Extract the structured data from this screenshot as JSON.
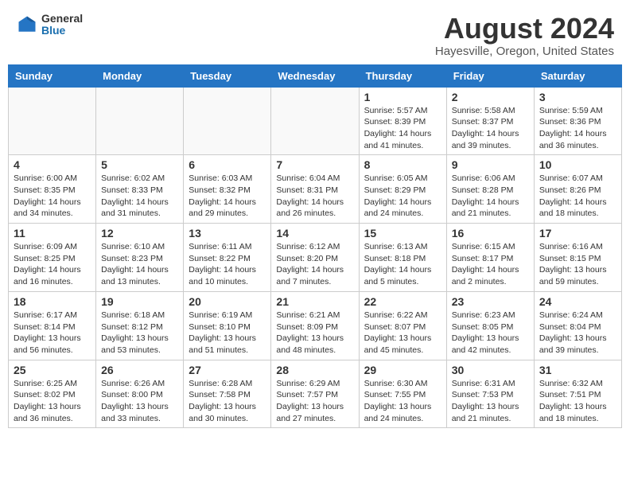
{
  "logo": {
    "general": "General",
    "blue": "Blue"
  },
  "title": "August 2024",
  "subtitle": "Hayesville, Oregon, United States",
  "days_of_week": [
    "Sunday",
    "Monday",
    "Tuesday",
    "Wednesday",
    "Thursday",
    "Friday",
    "Saturday"
  ],
  "weeks": [
    [
      {
        "day": "",
        "info": ""
      },
      {
        "day": "",
        "info": ""
      },
      {
        "day": "",
        "info": ""
      },
      {
        "day": "",
        "info": ""
      },
      {
        "day": "1",
        "info": "Sunrise: 5:57 AM\nSunset: 8:39 PM\nDaylight: 14 hours\nand 41 minutes."
      },
      {
        "day": "2",
        "info": "Sunrise: 5:58 AM\nSunset: 8:37 PM\nDaylight: 14 hours\nand 39 minutes."
      },
      {
        "day": "3",
        "info": "Sunrise: 5:59 AM\nSunset: 8:36 PM\nDaylight: 14 hours\nand 36 minutes."
      }
    ],
    [
      {
        "day": "4",
        "info": "Sunrise: 6:00 AM\nSunset: 8:35 PM\nDaylight: 14 hours\nand 34 minutes."
      },
      {
        "day": "5",
        "info": "Sunrise: 6:02 AM\nSunset: 8:33 PM\nDaylight: 14 hours\nand 31 minutes."
      },
      {
        "day": "6",
        "info": "Sunrise: 6:03 AM\nSunset: 8:32 PM\nDaylight: 14 hours\nand 29 minutes."
      },
      {
        "day": "7",
        "info": "Sunrise: 6:04 AM\nSunset: 8:31 PM\nDaylight: 14 hours\nand 26 minutes."
      },
      {
        "day": "8",
        "info": "Sunrise: 6:05 AM\nSunset: 8:29 PM\nDaylight: 14 hours\nand 24 minutes."
      },
      {
        "day": "9",
        "info": "Sunrise: 6:06 AM\nSunset: 8:28 PM\nDaylight: 14 hours\nand 21 minutes."
      },
      {
        "day": "10",
        "info": "Sunrise: 6:07 AM\nSunset: 8:26 PM\nDaylight: 14 hours\nand 18 minutes."
      }
    ],
    [
      {
        "day": "11",
        "info": "Sunrise: 6:09 AM\nSunset: 8:25 PM\nDaylight: 14 hours\nand 16 minutes."
      },
      {
        "day": "12",
        "info": "Sunrise: 6:10 AM\nSunset: 8:23 PM\nDaylight: 14 hours\nand 13 minutes."
      },
      {
        "day": "13",
        "info": "Sunrise: 6:11 AM\nSunset: 8:22 PM\nDaylight: 14 hours\nand 10 minutes."
      },
      {
        "day": "14",
        "info": "Sunrise: 6:12 AM\nSunset: 8:20 PM\nDaylight: 14 hours\nand 7 minutes."
      },
      {
        "day": "15",
        "info": "Sunrise: 6:13 AM\nSunset: 8:18 PM\nDaylight: 14 hours\nand 5 minutes."
      },
      {
        "day": "16",
        "info": "Sunrise: 6:15 AM\nSunset: 8:17 PM\nDaylight: 14 hours\nand 2 minutes."
      },
      {
        "day": "17",
        "info": "Sunrise: 6:16 AM\nSunset: 8:15 PM\nDaylight: 13 hours\nand 59 minutes."
      }
    ],
    [
      {
        "day": "18",
        "info": "Sunrise: 6:17 AM\nSunset: 8:14 PM\nDaylight: 13 hours\nand 56 minutes."
      },
      {
        "day": "19",
        "info": "Sunrise: 6:18 AM\nSunset: 8:12 PM\nDaylight: 13 hours\nand 53 minutes."
      },
      {
        "day": "20",
        "info": "Sunrise: 6:19 AM\nSunset: 8:10 PM\nDaylight: 13 hours\nand 51 minutes."
      },
      {
        "day": "21",
        "info": "Sunrise: 6:21 AM\nSunset: 8:09 PM\nDaylight: 13 hours\nand 48 minutes."
      },
      {
        "day": "22",
        "info": "Sunrise: 6:22 AM\nSunset: 8:07 PM\nDaylight: 13 hours\nand 45 minutes."
      },
      {
        "day": "23",
        "info": "Sunrise: 6:23 AM\nSunset: 8:05 PM\nDaylight: 13 hours\nand 42 minutes."
      },
      {
        "day": "24",
        "info": "Sunrise: 6:24 AM\nSunset: 8:04 PM\nDaylight: 13 hours\nand 39 minutes."
      }
    ],
    [
      {
        "day": "25",
        "info": "Sunrise: 6:25 AM\nSunset: 8:02 PM\nDaylight: 13 hours\nand 36 minutes."
      },
      {
        "day": "26",
        "info": "Sunrise: 6:26 AM\nSunset: 8:00 PM\nDaylight: 13 hours\nand 33 minutes."
      },
      {
        "day": "27",
        "info": "Sunrise: 6:28 AM\nSunset: 7:58 PM\nDaylight: 13 hours\nand 30 minutes."
      },
      {
        "day": "28",
        "info": "Sunrise: 6:29 AM\nSunset: 7:57 PM\nDaylight: 13 hours\nand 27 minutes."
      },
      {
        "day": "29",
        "info": "Sunrise: 6:30 AM\nSunset: 7:55 PM\nDaylight: 13 hours\nand 24 minutes."
      },
      {
        "day": "30",
        "info": "Sunrise: 6:31 AM\nSunset: 7:53 PM\nDaylight: 13 hours\nand 21 minutes."
      },
      {
        "day": "31",
        "info": "Sunrise: 6:32 AM\nSunset: 7:51 PM\nDaylight: 13 hours\nand 18 minutes."
      }
    ]
  ]
}
